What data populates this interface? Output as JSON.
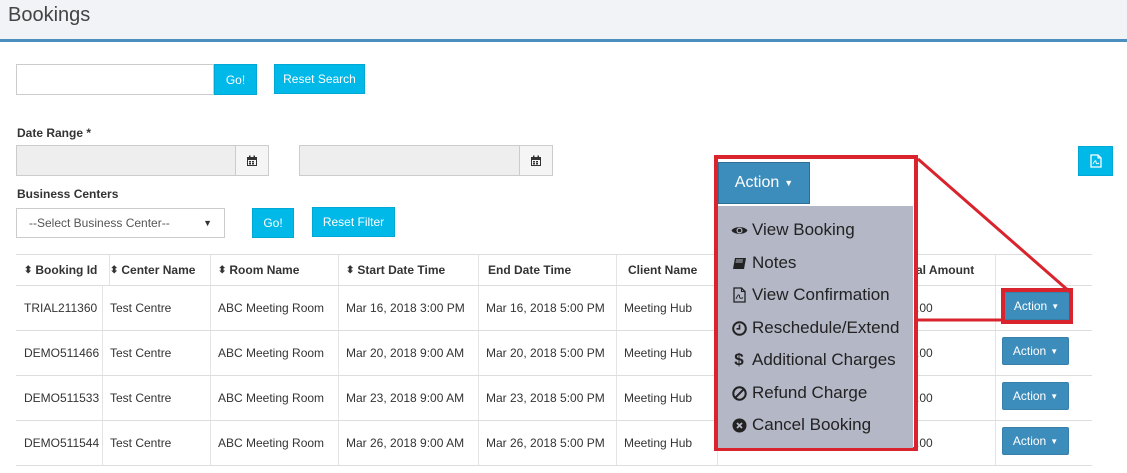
{
  "page": {
    "title": "Bookings"
  },
  "search": {
    "placeholder": "",
    "go_label": "Go!",
    "reset_label": "Reset Search"
  },
  "filters": {
    "date_range_label": "Date Range *",
    "start_date": "",
    "end_date": "",
    "business_centers_label": "Business Centers",
    "business_center_selected": "--Select Business Center--",
    "go_label": "Go!",
    "reset_label": "Reset Filter"
  },
  "export": {
    "icon": "pdf-file-icon"
  },
  "table": {
    "headers": [
      "Booking Id",
      "Center Name",
      "Room Name",
      "Start Date Time",
      "End Date Time",
      "Client Name",
      "",
      "al Amount",
      ""
    ],
    "sortable": [
      true,
      true,
      true,
      true,
      false,
      false,
      false,
      false,
      false
    ],
    "rows": [
      {
        "booking_id": "TRIAL211360",
        "center": "Test Centre",
        "room": "ABC Meeting Room",
        "start": "Mar 16, 2018 3:00 PM",
        "end": "Mar 16, 2018 5:00 PM",
        "client": "Meeting Hub",
        "amount": ".00",
        "action": "Action"
      },
      {
        "booking_id": "DEMO511466",
        "center": "Test Centre",
        "room": "ABC Meeting Room",
        "start": "Mar 20, 2018 9:00 AM",
        "end": "Mar 20, 2018 5:00 PM",
        "client": "Meeting Hub",
        "amount": ".00",
        "action": "Action"
      },
      {
        "booking_id": "DEMO511533",
        "center": "Test Centre",
        "room": "ABC Meeting Room",
        "start": "Mar 23, 2018 9:00 AM",
        "end": "Mar 23, 2018 5:00 PM",
        "client": "Meeting Hub",
        "amount": ".00",
        "action": "Action"
      },
      {
        "booking_id": "DEMO511544",
        "center": "Test Centre",
        "room": "ABC Meeting Room",
        "start": "Mar 26, 2018 9:00 AM",
        "end": "Mar 26, 2018 5:00 PM",
        "client": "Meeting Hub",
        "amount": ".00",
        "action": "Action"
      }
    ]
  },
  "action_menu": {
    "button_label": "Action",
    "items": [
      {
        "label": "View Booking",
        "icon": "eye-icon"
      },
      {
        "label": "Notes",
        "icon": "book-icon"
      },
      {
        "label": "View Confirmation",
        "icon": "pdf-file-icon"
      },
      {
        "label": "Reschedule/Extend",
        "icon": "clock-icon"
      },
      {
        "label": "Additional Charges",
        "icon": "dollar-icon"
      },
      {
        "label": "Refund Charge",
        "icon": "ban-icon"
      },
      {
        "label": "Cancel Booking",
        "icon": "times-circle-icon"
      }
    ]
  },
  "colors": {
    "accent_cyan": "#00b9e9",
    "action_blue": "#3c8dbc",
    "highlight_red": "#d9232d",
    "header_border": "#4a8fc0",
    "menu_bg": "#b4b7c6"
  }
}
